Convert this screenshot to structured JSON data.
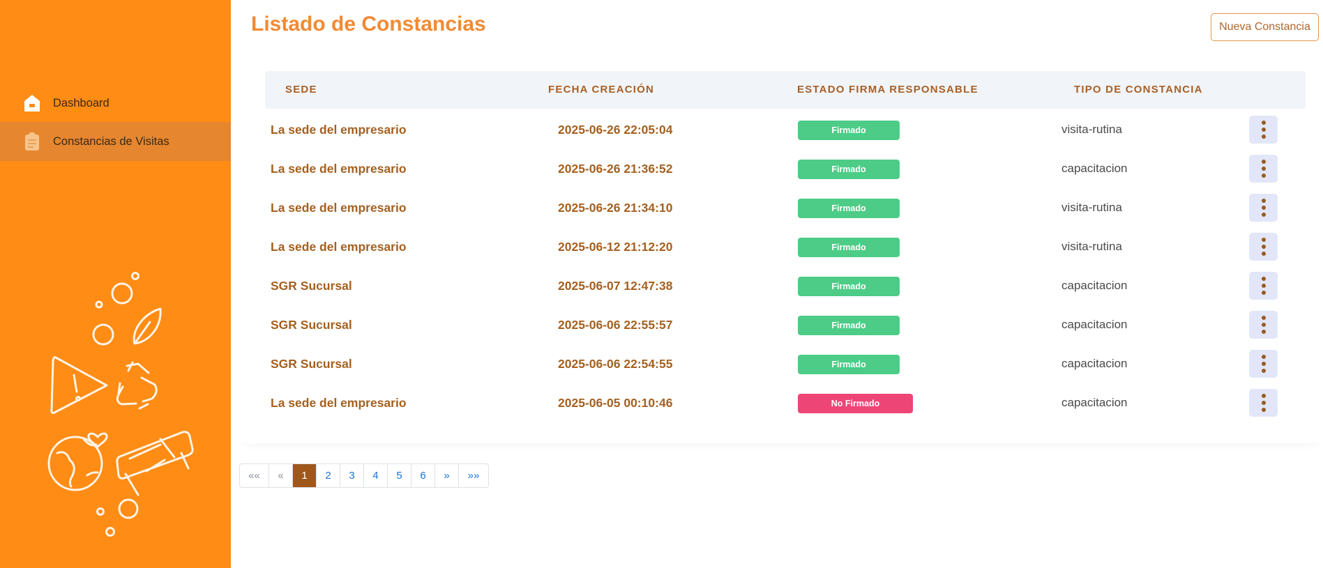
{
  "sidebar": {
    "items": [
      {
        "label": "Dashboard",
        "icon": "home-icon",
        "active": false
      },
      {
        "label": "Constancias de Visitas",
        "icon": "clipboard-icon",
        "active": true
      }
    ]
  },
  "header": {
    "title": "Listado de Constancias",
    "new_button": "Nueva Constancia"
  },
  "table": {
    "columns": [
      "SEDE",
      "FECHA CREACIÓN",
      "ESTADO FIRMA RESPONSABLE",
      "TIPO DE CONSTANCIA"
    ],
    "rows": [
      {
        "sede": "La sede del empresario",
        "fecha": "2025-06-26 22:05:04",
        "estado": "Firmado",
        "tipo": "visita-rutina"
      },
      {
        "sede": "La sede del empresario",
        "fecha": "2025-06-26 21:36:52",
        "estado": "Firmado",
        "tipo": "capacitacion"
      },
      {
        "sede": "La sede del empresario",
        "fecha": "2025-06-26 21:34:10",
        "estado": "Firmado",
        "tipo": "visita-rutina"
      },
      {
        "sede": "La sede del empresario",
        "fecha": "2025-06-12 21:12:20",
        "estado": "Firmado",
        "tipo": "visita-rutina"
      },
      {
        "sede": "SGR Sucursal",
        "fecha": "2025-06-07 12:47:38",
        "estado": "Firmado",
        "tipo": "capacitacion"
      },
      {
        "sede": "SGR Sucursal",
        "fecha": "2025-06-06 22:55:57",
        "estado": "Firmado",
        "tipo": "capacitacion"
      },
      {
        "sede": "SGR Sucursal",
        "fecha": "2025-06-06 22:54:55",
        "estado": "Firmado",
        "tipo": "capacitacion"
      },
      {
        "sede": "La sede del empresario",
        "fecha": "2025-06-05 00:10:46",
        "estado": "No Firmado",
        "tipo": "capacitacion"
      }
    ]
  },
  "pagination": {
    "first": "««",
    "prev": "«",
    "pages": [
      "1",
      "2",
      "3",
      "4",
      "5",
      "6"
    ],
    "current": "1",
    "next": "»",
    "last": "»»"
  },
  "colors": {
    "sidebar_bg": "#ff8c14",
    "accent": "#f18a33",
    "badge_signed": "#4ccc86",
    "badge_unsigned": "#ee4577",
    "page_active": "#a0571c"
  }
}
